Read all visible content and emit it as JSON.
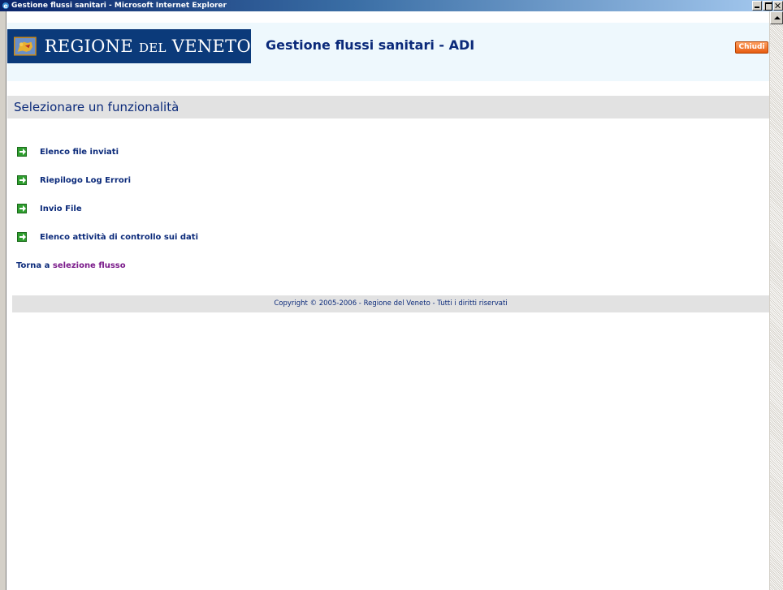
{
  "window": {
    "title": "Gestione flussi sanitari - Microsoft Internet Explorer"
  },
  "header": {
    "logo_text_main": "REGIONE ",
    "logo_text_small": "DEL",
    "logo_text_end": " VENETO",
    "app_title": "Gestione flussi sanitari - ADI",
    "close_label": "Chiudi"
  },
  "section": {
    "heading": "Selezionare un funzionalità"
  },
  "menu": {
    "items": [
      {
        "label": "Elenco file inviati",
        "icon": "arrow-right-icon"
      },
      {
        "label": "Riepilogo Log Errori",
        "icon": "arrow-right-icon"
      },
      {
        "label": "Invio File",
        "icon": "arrow-right-icon"
      },
      {
        "label": "Elenco attività di controllo sui dati",
        "icon": "arrow-right-icon"
      }
    ]
  },
  "back": {
    "prefix": "Torna a ",
    "link": "selezione flusso"
  },
  "footer": {
    "copyright": "Copyright © 2005-2006 - Regione del Veneto - Tutti i diritti riservati"
  },
  "colors": {
    "title_bar": "#0a246a",
    "brand_blue": "#0b3a7a",
    "text_blue": "#0b2a7a",
    "link_purple": "#7a1a8a",
    "close_orange": "#e65c10",
    "icon_green": "#2e9e2e",
    "band_gray": "#e2e2e2"
  }
}
